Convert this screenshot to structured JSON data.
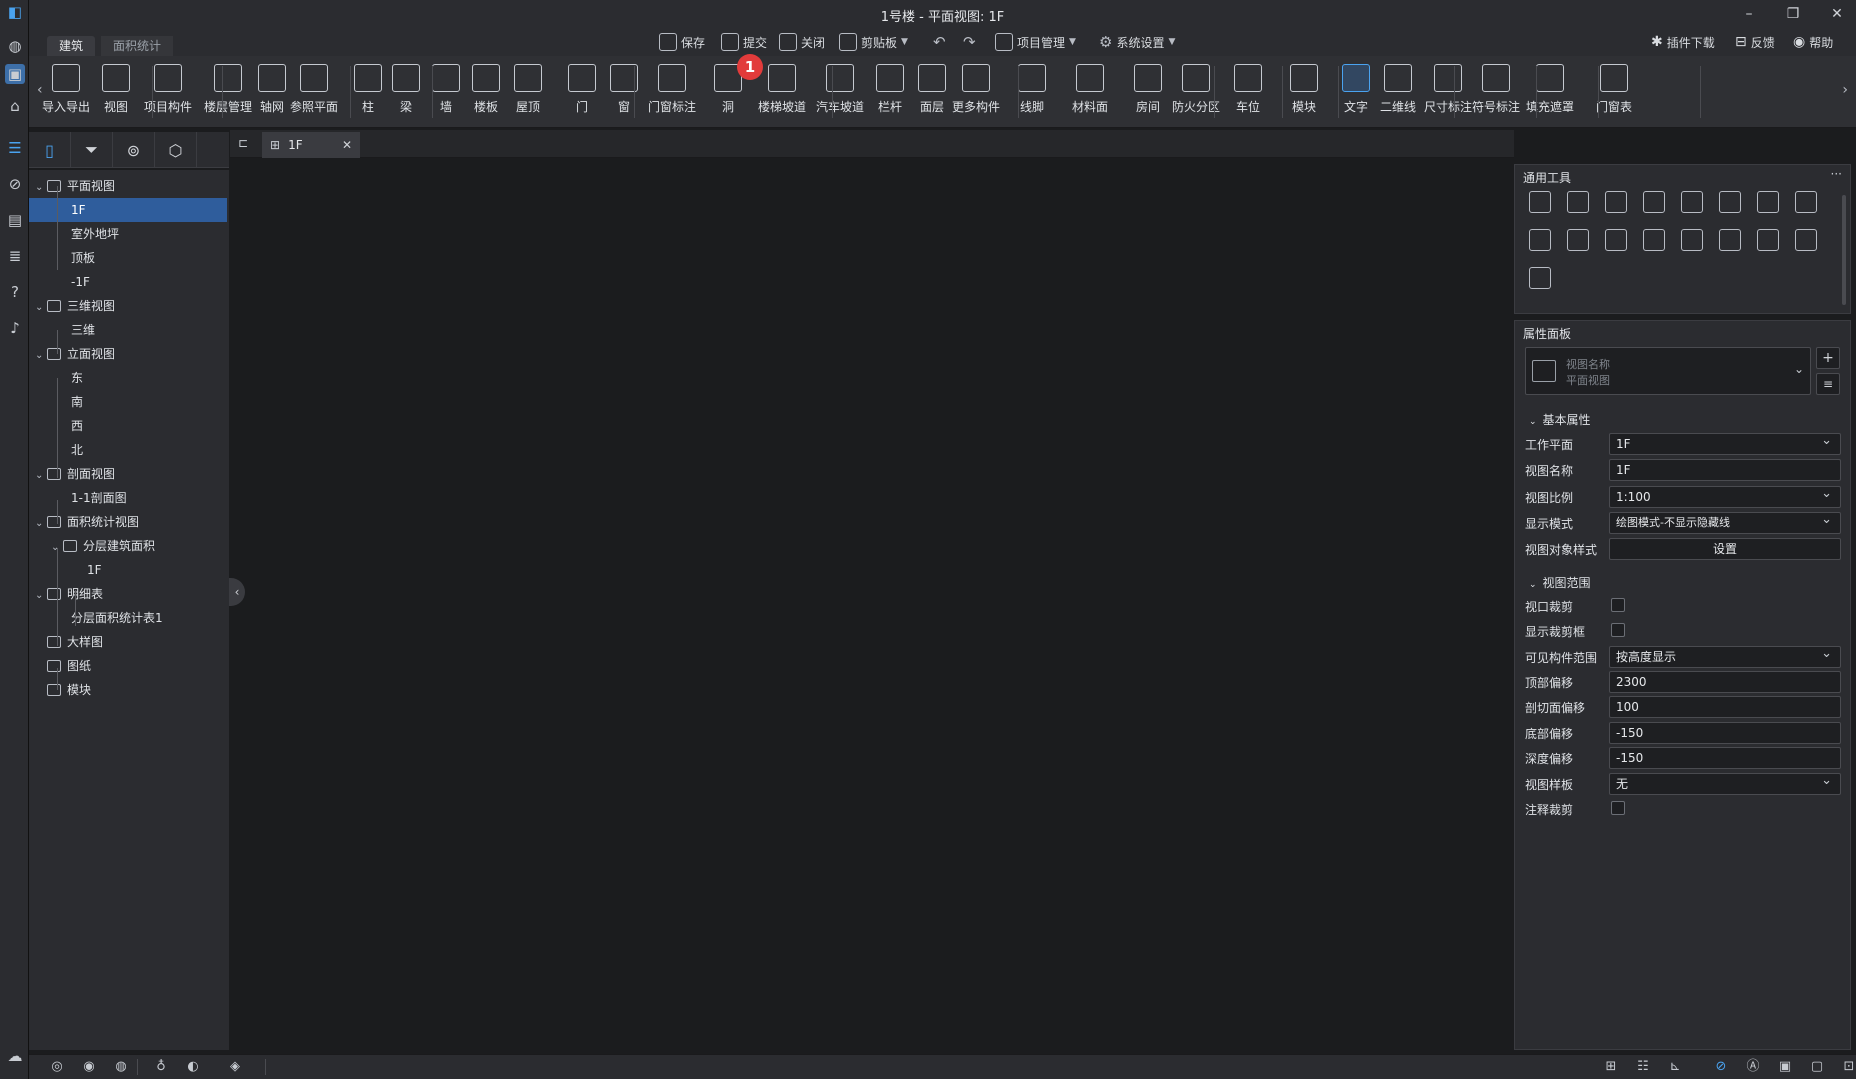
{
  "window": {
    "title": "1号楼 - 平面视图: 1F"
  },
  "ribbon_tabs": [
    {
      "label": "建筑",
      "active": true
    },
    {
      "label": "面积统计",
      "active": false
    }
  ],
  "quick_actions": {
    "save": "保存",
    "submit": "提交",
    "close": "关闭",
    "clipboard": "剪贴板",
    "project_mgmt": "项目管理",
    "system_settings": "系统设置"
  },
  "top_right": {
    "plugin_download": "插件下载",
    "feedback": "反馈",
    "help": "帮助"
  },
  "ribbon_buttons": [
    {
      "label": "导入导出",
      "icon": "cad-import-icon"
    },
    {
      "label": "视图",
      "icon": "view-icon"
    },
    {
      "label": "项目构件",
      "icon": "project-component-icon"
    },
    {
      "label": "楼层管理",
      "icon": "floor-management-icon"
    },
    {
      "label": "轴网",
      "icon": "axis-grid-icon"
    },
    {
      "label": "参照平面",
      "icon": "reference-plane-icon"
    },
    {
      "label": "柱",
      "icon": "column-icon"
    },
    {
      "label": "梁",
      "icon": "beam-icon"
    },
    {
      "label": "墙",
      "icon": "wall-icon"
    },
    {
      "label": "楼板",
      "icon": "slab-icon"
    },
    {
      "label": "屋顶",
      "icon": "roof-icon"
    },
    {
      "label": "门",
      "icon": "door-icon"
    },
    {
      "label": "窗",
      "icon": "window-icon"
    },
    {
      "label": "门窗标注",
      "icon": "door-window-tag-icon"
    },
    {
      "label": "洞",
      "icon": "opening-icon"
    },
    {
      "label": "楼梯坡道",
      "icon": "stair-ramp-icon"
    },
    {
      "label": "汽车坡道",
      "icon": "car-ramp-icon"
    },
    {
      "label": "栏杆",
      "icon": "railing-icon"
    },
    {
      "label": "面层",
      "icon": "finish-layer-icon"
    },
    {
      "label": "更多构件",
      "icon": "more-components-icon"
    },
    {
      "label": "线脚",
      "icon": "molding-icon"
    },
    {
      "label": "材料面",
      "icon": "material-face-icon"
    },
    {
      "label": "房间",
      "icon": "room-icon"
    },
    {
      "label": "防火分区",
      "icon": "fire-zone-icon"
    },
    {
      "label": "车位",
      "icon": "parking-icon"
    },
    {
      "label": "模块",
      "icon": "module-icon"
    },
    {
      "label": "文字",
      "icon": "text-icon"
    },
    {
      "label": "二维线",
      "icon": "2d-line-icon"
    },
    {
      "label": "尺寸标注",
      "icon": "dimension-icon"
    },
    {
      "label": "符号标注",
      "icon": "symbol-tag-icon"
    },
    {
      "label": "填充遮罩",
      "icon": "fill-mask-icon"
    },
    {
      "label": "门窗表",
      "icon": "door-window-schedule-icon"
    }
  ],
  "badge_count": "1",
  "tree": [
    {
      "label": "平面视图"
    },
    {
      "label": "1F"
    },
    {
      "label": "室外地坪"
    },
    {
      "label": "顶板"
    },
    {
      "label": "-1F"
    },
    {
      "label": "三维视图"
    },
    {
      "label": "三维"
    },
    {
      "label": "立面视图"
    },
    {
      "label": "东"
    },
    {
      "label": "南"
    },
    {
      "label": "西"
    },
    {
      "label": "北"
    },
    {
      "label": "剖面视图"
    },
    {
      "label": "1-1剖面图"
    },
    {
      "label": "面积统计视图"
    },
    {
      "label": "分层建筑面积"
    },
    {
      "label": "1F"
    },
    {
      "label": "明细表"
    },
    {
      "label": "分层面积统计表1"
    },
    {
      "label": "大样图"
    },
    {
      "label": "图纸"
    },
    {
      "label": "模块"
    }
  ],
  "doc_tab": {
    "label": "1F"
  },
  "tools_panel": {
    "title": "通用工具",
    "more": "···"
  },
  "props_panel": {
    "title": "属性面板",
    "view_type_name": "视图名称",
    "view_type_value": "平面视图",
    "section_basic": "基本属性",
    "section_range": "视图范围",
    "fields": {
      "work_plane": {
        "label": "工作平面",
        "value": "1F"
      },
      "view_name": {
        "label": "视图名称",
        "value": "1F"
      },
      "view_scale": {
        "label": "视图比例",
        "value": "1:100"
      },
      "display_mode": {
        "label": "显示模式",
        "value": "绘图模式-不显示隐藏线"
      },
      "object_style": {
        "label": "视图对象样式",
        "value": "设置"
      },
      "crop_view": {
        "label": "视口裁剪"
      },
      "show_crop": {
        "label": "显示裁剪框"
      },
      "visible_range": {
        "label": "可见构件范围",
        "value": "按高度显示"
      },
      "top_offset": {
        "label": "顶部偏移",
        "value": "2300"
      },
      "cut_offset": {
        "label": "剖切面偏移",
        "value": "100"
      },
      "bottom_offset": {
        "label": "底部偏移",
        "value": "-150"
      },
      "depth_offset": {
        "label": "深度偏移",
        "value": "-150"
      },
      "view_template": {
        "label": "视图样板",
        "value": "无"
      },
      "annotation_crop": {
        "label": "注释裁剪"
      }
    }
  },
  "colors": {
    "accent": "#2f5d9c",
    "badge": "#e23b3b",
    "background": "#1b1c1e",
    "panel": "#2b2c30"
  }
}
